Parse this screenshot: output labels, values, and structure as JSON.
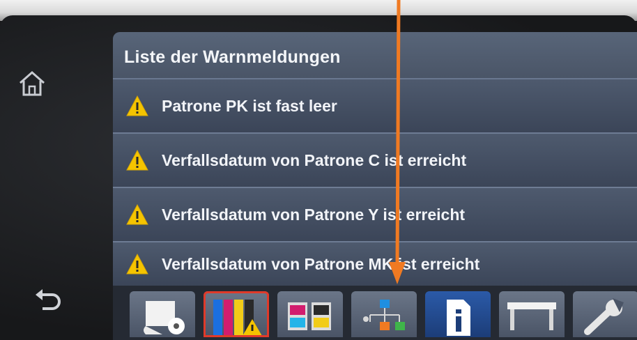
{
  "screen": {
    "title": "Liste der Warnmeldungen",
    "warnings": [
      {
        "text": "Patrone PK ist fast leer",
        "icon": "warning-triangle-icon"
      },
      {
        "text": "Verfallsdatum von Patrone C ist erreicht",
        "icon": "warning-triangle-icon"
      },
      {
        "text": "Verfallsdatum von Patrone Y ist erreicht",
        "icon": "warning-triangle-icon"
      },
      {
        "text": "Verfallsdatum von Patrone MK ist erreicht",
        "icon": "warning-triangle-icon"
      }
    ]
  },
  "side_buttons": {
    "home_icon": "home-icon",
    "back_icon": "back-arrow-icon"
  },
  "toolbar": {
    "buttons": [
      {
        "name": "paper-roll-icon"
      },
      {
        "name": "ink-cartridges-icon",
        "state": "alert"
      },
      {
        "name": "printheads-icon"
      },
      {
        "name": "network-icon"
      },
      {
        "name": "info-icon",
        "state": "selected"
      },
      {
        "name": "printer-platen-icon"
      },
      {
        "name": "wrench-icon"
      }
    ]
  },
  "colors": {
    "warning_yellow": "#f5c400",
    "alert_outline": "#e03a2a",
    "annotation_arrow": "#f07a22"
  }
}
